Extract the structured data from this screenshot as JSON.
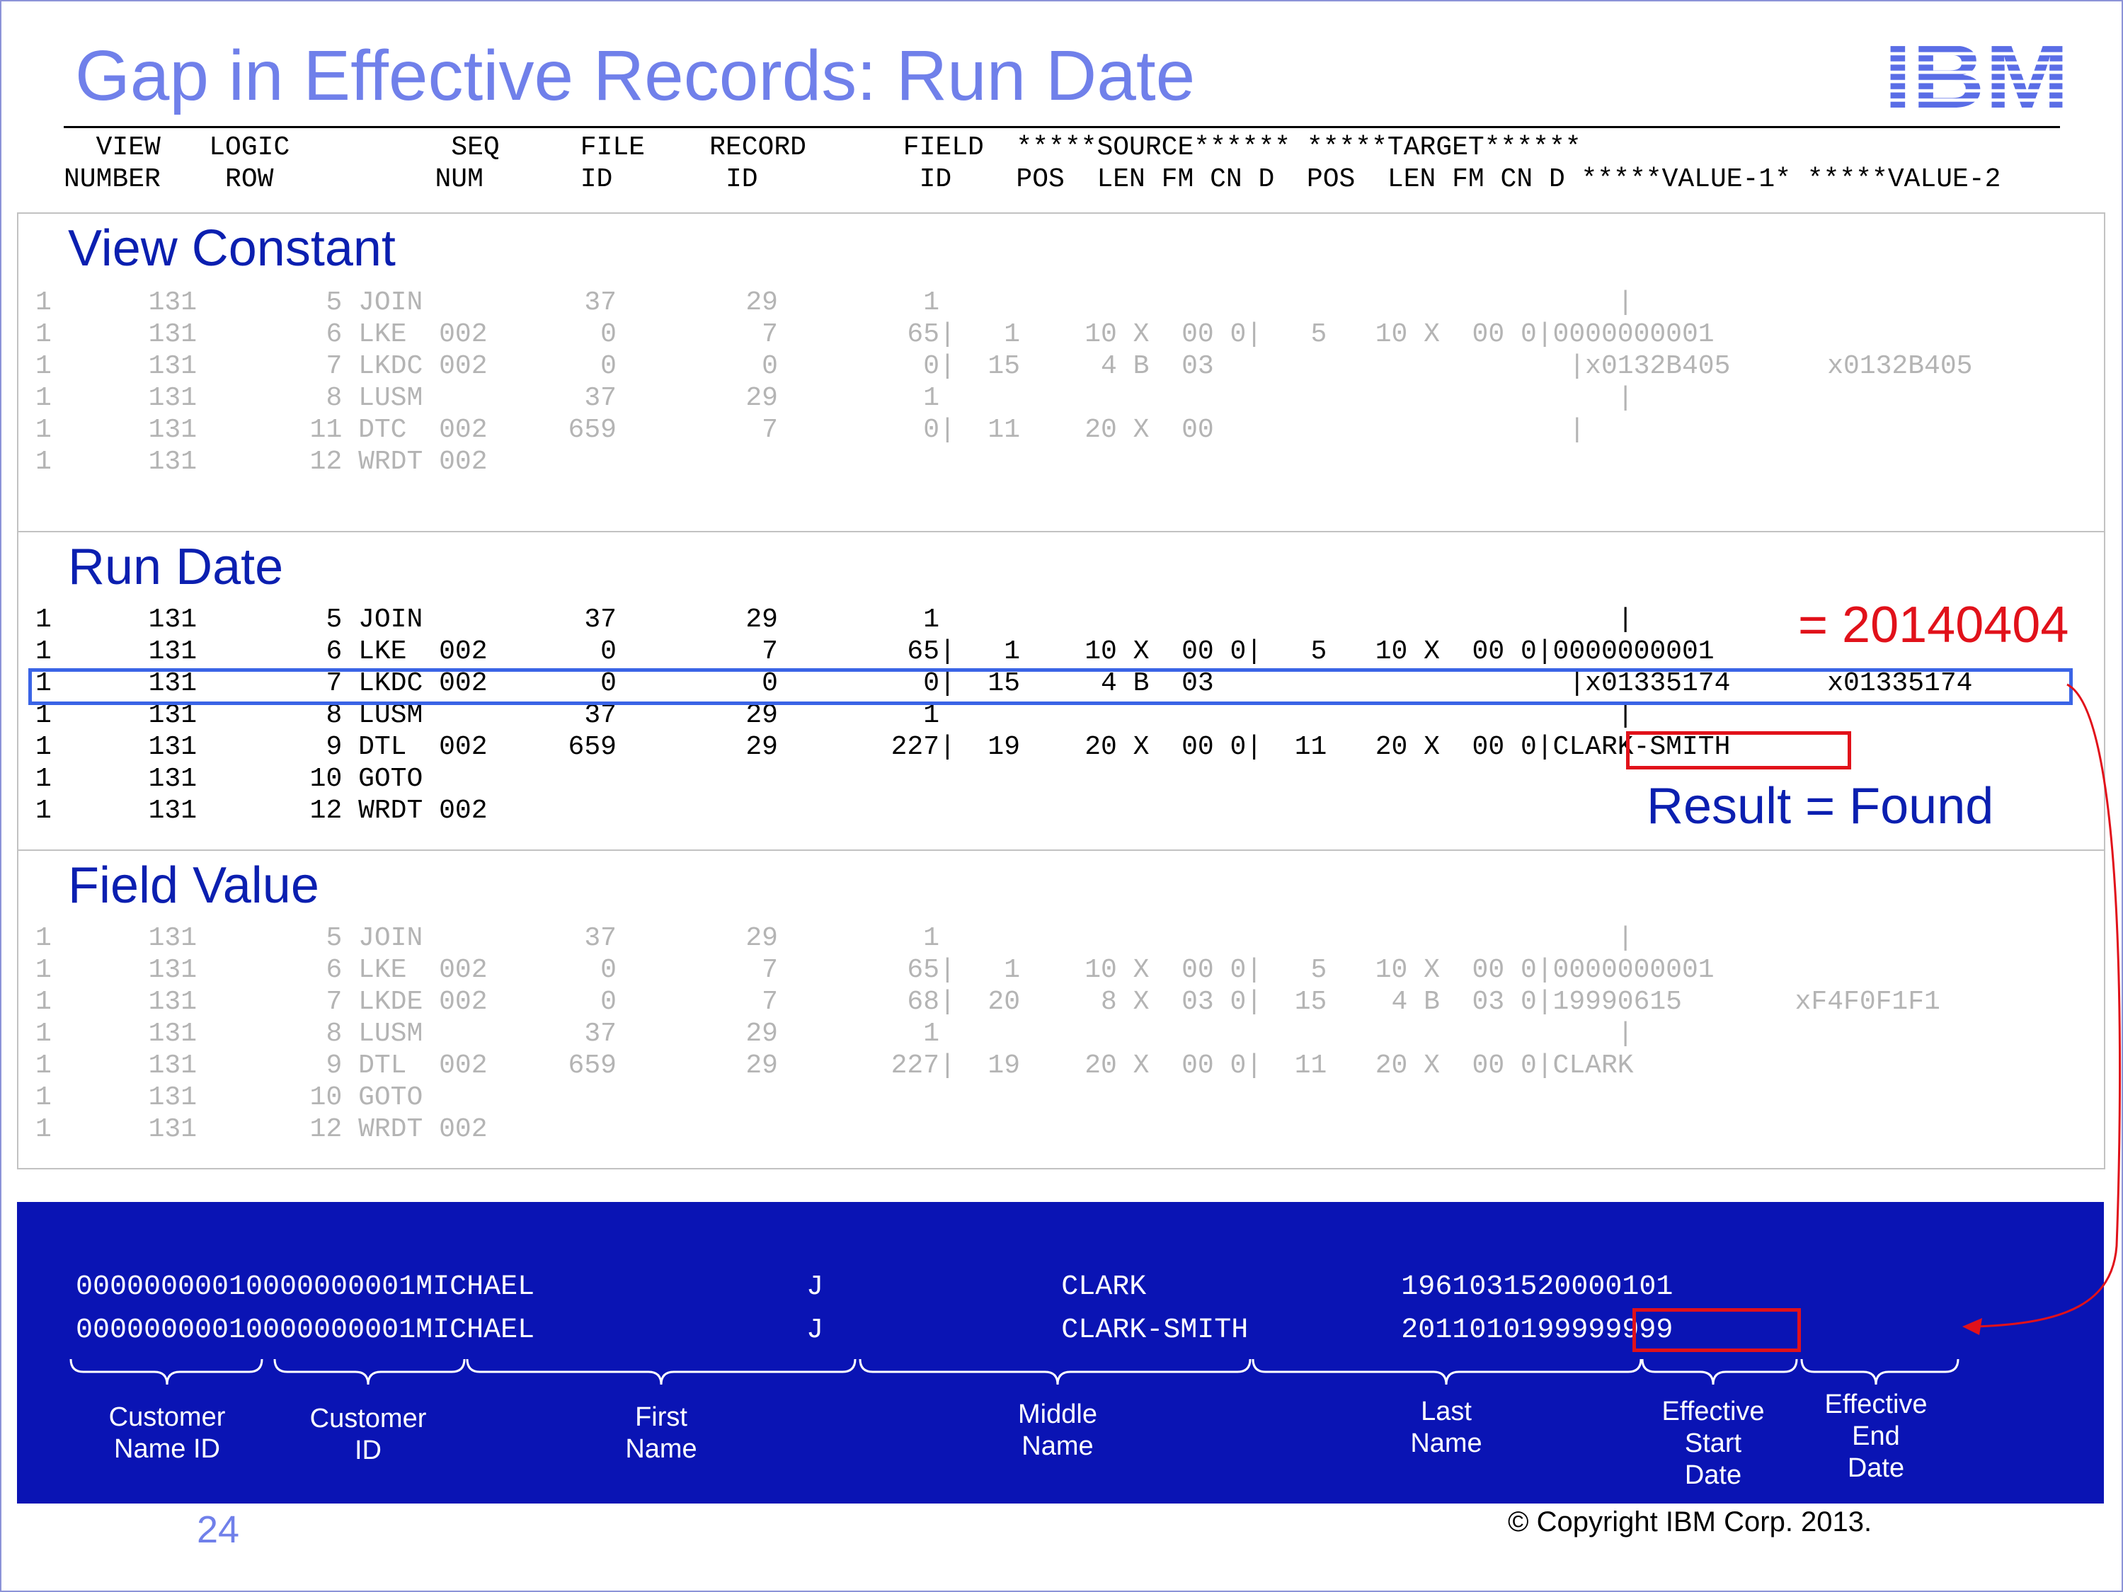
{
  "title": "Gap in Effective Records: Run Date",
  "logo_text": "IBM",
  "header": {
    "line1": "  VIEW   LOGIC          SEQ     FILE    RECORD      FIELD  *****SOURCE****** *****TARGET******",
    "line2": "NUMBER    ROW          NUM      ID       ID          ID    POS  LEN FM CN D  POS  LEN FM CN D *****VALUE-1* *****VALUE-2"
  },
  "sections": {
    "view_constant": {
      "title": "View Constant",
      "rows": [
        "1      131        5 JOIN          37        29         1                                          |",
        "1      131        6 LKE  002       0         7        65|   1    10 X  00 0|   5   10 X  00 0|0000000001",
        "1      131        7 LKDC 002       0         0         0|  15     4 B  03                      |x0132B405      x0132B405",
        "1      131        8 LUSM          37        29         1                                          |",
        "1      131       11 DTC  002     659         7         0|  11    20 X  00                      |",
        "1      131       12 WRDT 002"
      ]
    },
    "run_date": {
      "title": "Run Date",
      "rows": [
        "1      131        5 JOIN          37        29         1                                          |",
        "1      131        6 LKE  002       0         7        65|   1    10 X  00 0|   5   10 X  00 0|0000000001",
        "1      131        7 LKDC 002       0         0         0|  15     4 B  03                      |x01335174      x01335174",
        "1      131        8 LUSM          37        29         1                                          |",
        "1      131        9 DTL  002     659        29       227|  19    20 X  00 0|  11   20 X  00 0|CLARK-SMITH",
        "1      131       10 GOTO",
        "1      131       12 WRDT 002"
      ]
    },
    "field_value": {
      "title": "Field  Value",
      "rows": [
        "1      131        5 JOIN          37        29         1                                          |",
        "1      131        6 LKE  002       0         7        65|   1    10 X  00 0|   5   10 X  00 0|0000000001",
        "1      131        7 LKDE 002       0         7        68|  20     8 X  03 0|  15    4 B  03 0|19990615       xF4F0F1F1",
        "1      131        8 LUSM          37        29         1                                          |",
        "1      131        9 DTL  002     659        29       227|  19    20 X  00 0|  11   20 X  00 0|CLARK",
        "1      131       10 GOTO",
        "1      131       12 WRDT 002"
      ]
    }
  },
  "annotations": {
    "run_date_value": "= 20140404",
    "result": "Result = Found"
  },
  "records": [
    "00000000010000000001MICHAEL                J              CLARK               1961031520000101",
    "00000000010000000001MICHAEL                J              CLARK-SMITH         2011010199999999"
  ],
  "field_labels": [
    {
      "line1": "Customer",
      "line2": "Name ID"
    },
    {
      "line1": "Customer",
      "line2": "ID"
    },
    {
      "line1": "First",
      "line2": "Name"
    },
    {
      "line1": "Middle",
      "line2": "Name"
    },
    {
      "line1": "Last",
      "line2": "Name"
    },
    {
      "line1": "Effective",
      "line2": "Start",
      "line3": "Date"
    },
    {
      "line1": "Effective",
      "line2": "End",
      "line3": "Date"
    }
  ],
  "page_number": "24",
  "copyright": "© Copyright IBM Corp. 2013.",
  "colors": {
    "title": "#7080ea",
    "section_title": "#0b1fb0",
    "highlight_blue": "#3a64e6",
    "highlight_red": "#e1111a",
    "record_panel": "#0a14b4",
    "dim_text": "#b4b4b4"
  }
}
